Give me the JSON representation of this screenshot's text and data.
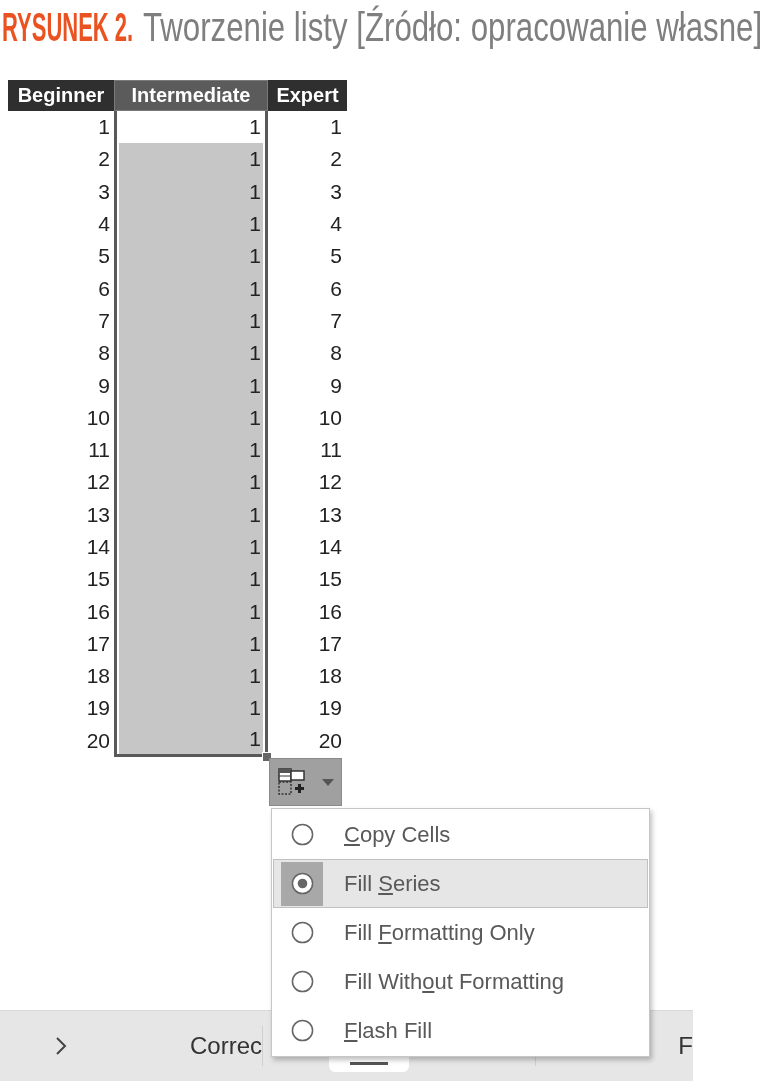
{
  "figure": {
    "label": "RYSUNEK 2.",
    "caption": "Tworzenie listy [Źródło: opracowanie własne]"
  },
  "table": {
    "columns": [
      {
        "label": "Beginner",
        "selected": false
      },
      {
        "label": "Intermediate",
        "selected": true
      },
      {
        "label": "Expert",
        "selected": false
      }
    ],
    "rows": [
      {
        "cells": [
          "1",
          "1",
          "1"
        ],
        "active": true
      },
      {
        "cells": [
          "2",
          "1",
          "2"
        ],
        "active": false
      },
      {
        "cells": [
          "3",
          "1",
          "3"
        ],
        "active": false
      },
      {
        "cells": [
          "4",
          "1",
          "4"
        ],
        "active": false
      },
      {
        "cells": [
          "5",
          "1",
          "5"
        ],
        "active": false
      },
      {
        "cells": [
          "6",
          "1",
          "6"
        ],
        "active": false
      },
      {
        "cells": [
          "7",
          "1",
          "7"
        ],
        "active": false
      },
      {
        "cells": [
          "8",
          "1",
          "8"
        ],
        "active": false
      },
      {
        "cells": [
          "9",
          "1",
          "9"
        ],
        "active": false
      },
      {
        "cells": [
          "10",
          "1",
          "10"
        ],
        "active": false
      },
      {
        "cells": [
          "11",
          "1",
          "11"
        ],
        "active": false
      },
      {
        "cells": [
          "12",
          "1",
          "12"
        ],
        "active": false
      },
      {
        "cells": [
          "13",
          "1",
          "13"
        ],
        "active": false
      },
      {
        "cells": [
          "14",
          "1",
          "14"
        ],
        "active": false
      },
      {
        "cells": [
          "15",
          "1",
          "15"
        ],
        "active": false
      },
      {
        "cells": [
          "16",
          "1",
          "16"
        ],
        "active": false
      },
      {
        "cells": [
          "17",
          "1",
          "17"
        ],
        "active": false
      },
      {
        "cells": [
          "18",
          "1",
          "18"
        ],
        "active": false
      },
      {
        "cells": [
          "19",
          "1",
          "19"
        ],
        "active": false
      },
      {
        "cells": [
          "20",
          "1",
          "20"
        ],
        "active": false
      }
    ]
  },
  "fill_options_button": {
    "expanded": true
  },
  "menu": {
    "items": [
      {
        "access_key": "C",
        "rest": "opy Cells",
        "selected": false
      },
      {
        "before": "Fill ",
        "access_key": "S",
        "rest": "eries",
        "selected": true
      },
      {
        "before": "Fill ",
        "access_key": "F",
        "rest": "ormatting Only",
        "selected": false
      },
      {
        "before": "Fill With",
        "access_key": "o",
        "rest": "ut Formatting",
        "selected": false
      },
      {
        "access_key": "F",
        "rest": "lash Fill",
        "selected": false
      }
    ]
  },
  "bottom_bar": {
    "texts": [
      "Correc",
      "F"
    ]
  }
}
